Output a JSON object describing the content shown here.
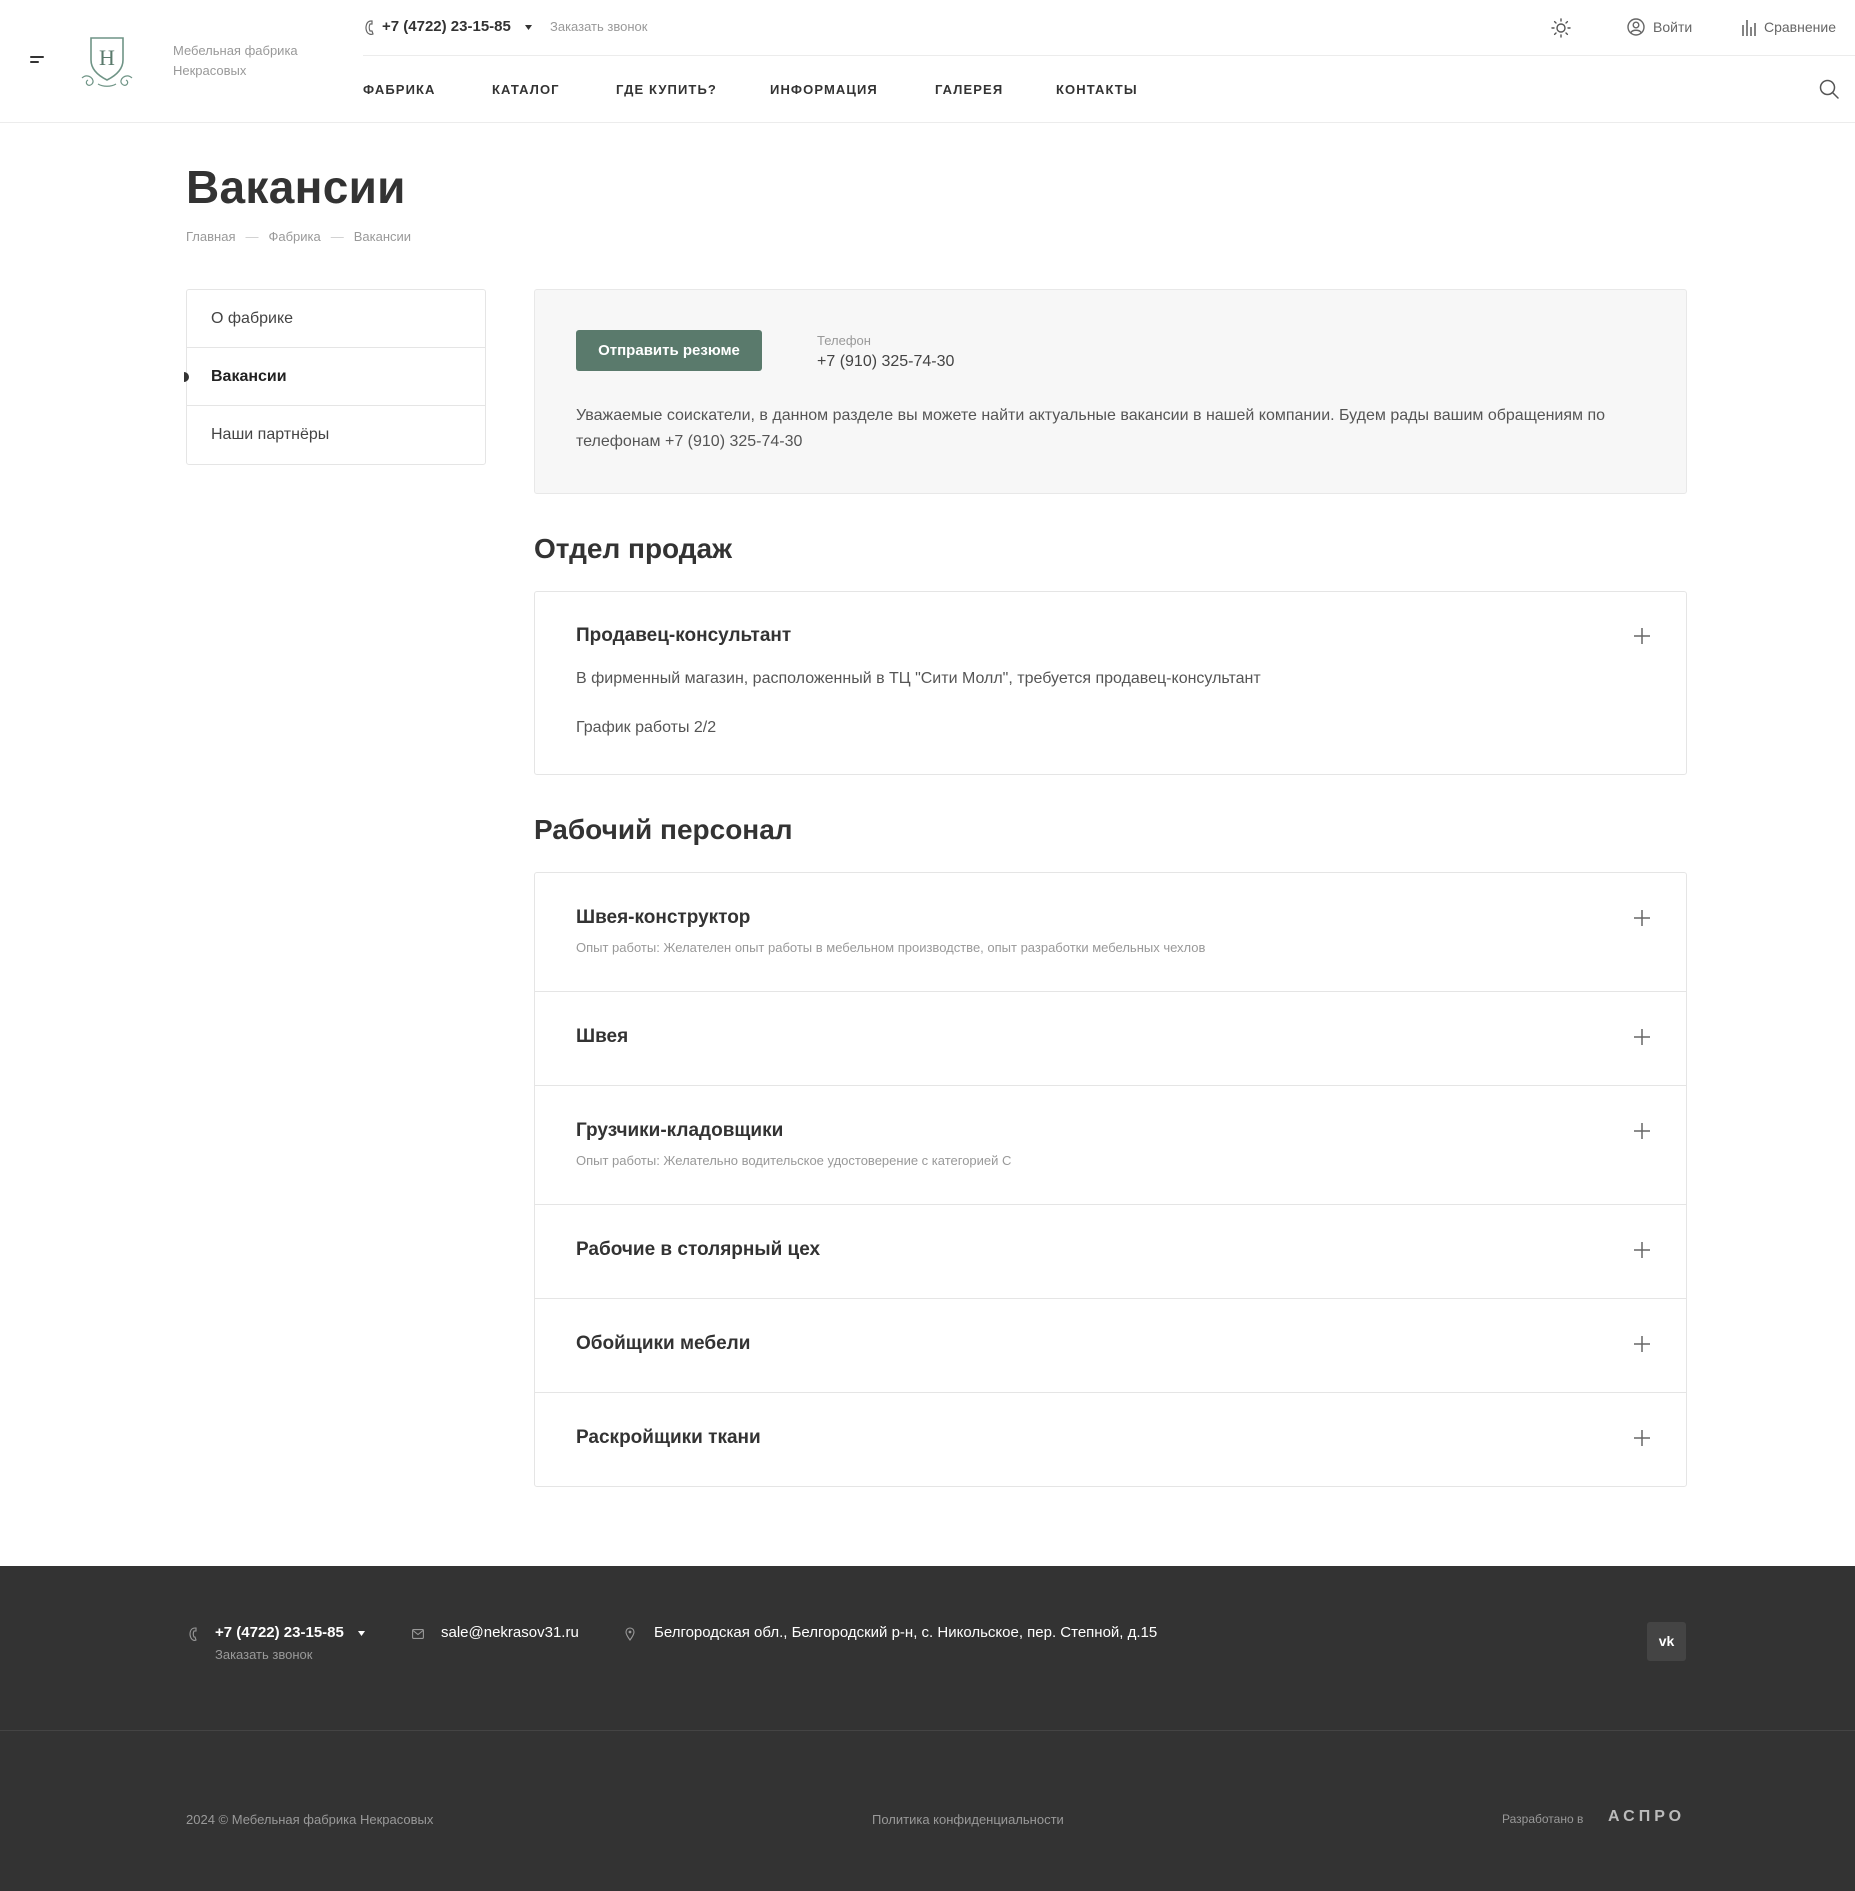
{
  "header": {
    "slogan": "Мебельная фабрика Некрасовых",
    "logo_letter": "H",
    "phone": "+7 (4722) 23-15-85",
    "callback": "Заказать звонок",
    "login": "Войти",
    "compare": "Сравнение",
    "nav": [
      "ФАБРИКА",
      "КАТАЛОГ",
      "ГДЕ КУПИТЬ?",
      "ИНФОРМАЦИЯ",
      "ГАЛЕРЕЯ",
      "КОНТАКТЫ"
    ],
    "icons": [
      "menu-icon",
      "phone-icon",
      "caret-down-icon",
      "theme-sun-icon",
      "user-icon",
      "compare-chart-icon",
      "search-icon"
    ]
  },
  "page": {
    "title": "Вакансии",
    "breadcrumb": [
      "Главная",
      "Фабрика",
      "Вакансии"
    ]
  },
  "sidebar": {
    "items": [
      "О фабрике",
      "Вакансии",
      "Наши партнёры"
    ],
    "active_index": 1
  },
  "intro": {
    "button": "Отправить резюме",
    "phone_label": "Телефон",
    "phone": "+7 (910) 325-74-30",
    "text": "Уважаемые соискатели, в данном разделе вы можете найти актуальные вакансии в нашей компании. Будем рады вашим обращениям по телефонам +7 (910) 325-74-30"
  },
  "sections": [
    {
      "title": "Отдел продаж",
      "vacancies": [
        {
          "title": "Продавец-консультант",
          "desc1": "В фирменный магазин, расположенный в ТЦ \"Сити Молл\", требуется продавец-консультант",
          "desc2": "График работы 2/2"
        }
      ]
    },
    {
      "title": "Рабочий персонал",
      "vacancies": [
        {
          "title": "Швея-конструктор",
          "sub": "Опыт работы: Желателен опыт работы в мебельном производстве, опыт разработки мебельных чехлов"
        },
        {
          "title": "Швея"
        },
        {
          "title": "Грузчики-кладовщики",
          "sub": "Опыт работы: Желательно водительское удостоверение с категорией С"
        },
        {
          "title": "Рабочие в столярный цех"
        },
        {
          "title": "Обойщики мебели"
        },
        {
          "title": "Раскройщики ткани"
        }
      ]
    }
  ],
  "footer": {
    "phone": "+7 (4722) 23-15-85",
    "callback": "Заказать звонок",
    "email": "sale@nekrasov31.ru",
    "address": "Белгородская обл., Белгородский р-н, с. Никольское, пер. Степной, д.15",
    "vk": "vk",
    "copyright": "2024 © Мебельная фабрика Некрасовых",
    "policy": "Политика конфиденциальности",
    "developed_by": "Разработано в",
    "developer": "АСПРО"
  },
  "colors": {
    "accent": "#5a7a6c",
    "footer_bg": "#333333",
    "text": "#333333",
    "muted": "#999999"
  }
}
